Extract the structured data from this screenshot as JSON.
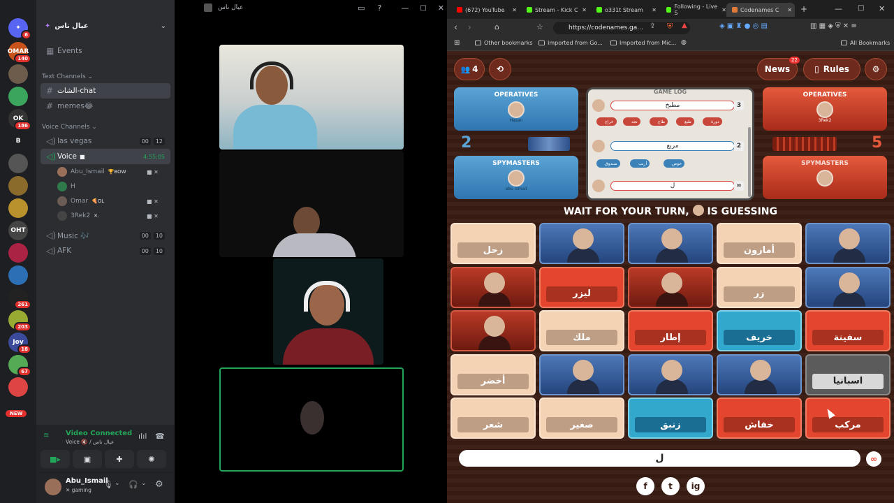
{
  "discord": {
    "server_name": "عيال ناس",
    "servers": [
      {
        "label": "OMAR",
        "badge": "140",
        "color": "#c8541b"
      },
      {
        "label": "",
        "badge": "",
        "color": "#6d5c4b"
      },
      {
        "label": "",
        "badge": "",
        "color": "#3ba55d"
      },
      {
        "label": "OK",
        "badge": "186",
        "color": "#333"
      },
      {
        "label": "B",
        "badge": "",
        "color": "#1e1f22"
      },
      {
        "label": "",
        "badge": "",
        "color": "#555"
      },
      {
        "label": "",
        "badge": "",
        "color": "#8a6b2c"
      },
      {
        "label": "",
        "badge": "",
        "color": "#b9912d"
      },
      {
        "label": "OHT",
        "badge": "",
        "color": "#444"
      },
      {
        "label": "",
        "badge": "",
        "color": "#a24"
      },
      {
        "label": "",
        "badge": "",
        "color": "#2c6fb5"
      },
      {
        "label": "",
        "badge": "261",
        "color": "#222"
      },
      {
        "label": "",
        "badge": "203",
        "color": "#9a3"
      },
      {
        "label": "Joy",
        "badge": "18",
        "color": "#3b4a9a"
      },
      {
        "label": "",
        "badge": "67",
        "color": "#5a5"
      },
      {
        "label": "",
        "badge": "",
        "color": "#d44"
      }
    ],
    "home_badge": "6",
    "new_label": "NEW",
    "events": "Events",
    "text_channels_label": "Text Channels",
    "text_channels": [
      "الشات-chat",
      "memes😂"
    ],
    "voice_channels_label": "Voice Channels",
    "voice_channels": [
      {
        "name": "las vegas",
        "a": "00",
        "b": "12"
      },
      {
        "name": "Voice",
        "time": "4:55:05"
      }
    ],
    "voice_users": [
      {
        "name": "Abu_Ismail",
        "tag": "🏆BOW"
      },
      {
        "name": "H",
        "tag": ""
      },
      {
        "name": "Omar",
        "tag": "🍕OL"
      },
      {
        "name": "3Rek2",
        "tag": "✕."
      }
    ],
    "other_channels": [
      {
        "name": "Music 🎶",
        "a": "00",
        "b": "10"
      },
      {
        "name": "AFK",
        "a": "00",
        "b": "10"
      }
    ],
    "connection_status": "Video Connected",
    "connection_detail": "Voice 🔇 / عيال ناس",
    "username": "Abu_Ismail",
    "user_status": "✕ gaming"
  },
  "stage": {
    "title": "عيال ناس"
  },
  "browser": {
    "tabs": [
      {
        "label": "(672) YouTube",
        "color": "#f00"
      },
      {
        "label": "Stream - Kick C",
        "color": "#53fc18"
      },
      {
        "label": "o331t Stream",
        "color": "#53fc18"
      },
      {
        "label": "Following - Live S",
        "color": "#53fc18"
      },
      {
        "label": "Codenames C",
        "color": "#e07a3a"
      }
    ],
    "url": "https://codenames.ga...",
    "bookmarks": [
      "Other bookmarks",
      "Imported from Go...",
      "Imported from Mic..."
    ],
    "all_bookmarks": "All Bookmarks"
  },
  "game": {
    "player_count": "4",
    "news_label": "News",
    "news_badge": "22",
    "rules_label": "Rules",
    "blue": {
      "operatives_label": "OPERATIVES",
      "operative": "Hasan",
      "spymasters_label": "SPYMASTERS",
      "spymaster": "abu Ismail",
      "score": "2"
    },
    "red": {
      "operatives_label": "OPERATIVES",
      "operative": "3Rek2",
      "spymasters_label": "SPYMASTERS",
      "spymaster": "",
      "score": "5"
    },
    "game_log_label": "GAME LOG",
    "log": [
      {
        "clue": "مطبخ",
        "n": "3",
        "team": "red"
      },
      {
        "clue": "مربع",
        "n": "2",
        "team": "blue"
      },
      {
        "clue": "ل",
        "n": "∞",
        "team": "red"
      }
    ],
    "log_chips_red": [
      "خراج",
      "نجد",
      "طاع",
      "طبع",
      "دورة"
    ],
    "log_chips_blue": [
      "صندوق",
      "أرنب",
      "حوض"
    ],
    "status_text": "WAIT FOR YOUR TURN,",
    "status_suffix": "IS GUESSING",
    "cards": [
      {
        "w": "زحل",
        "t": "n"
      },
      {
        "w": "",
        "t": "pb"
      },
      {
        "w": "",
        "t": "pb"
      },
      {
        "w": "أمازون",
        "t": "n"
      },
      {
        "w": "",
        "t": "pb"
      },
      {
        "w": "",
        "t": "pr"
      },
      {
        "w": "ليزر",
        "t": "r"
      },
      {
        "w": "",
        "t": "pr"
      },
      {
        "w": "زر",
        "t": "n"
      },
      {
        "w": "",
        "t": "pb"
      },
      {
        "w": "",
        "t": "pr"
      },
      {
        "w": "ملك",
        "t": "n"
      },
      {
        "w": "إطار",
        "t": "r"
      },
      {
        "w": "خريف",
        "t": "b"
      },
      {
        "w": "سفينة",
        "t": "r"
      },
      {
        "w": "أخضر",
        "t": "n"
      },
      {
        "w": "",
        "t": "pb"
      },
      {
        "w": "",
        "t": "pb"
      },
      {
        "w": "",
        "t": "pb"
      },
      {
        "w": "اسبانيا",
        "t": "a"
      },
      {
        "w": "شعر",
        "t": "n"
      },
      {
        "w": "صغير",
        "t": "n"
      },
      {
        "w": "زنبق",
        "t": "b"
      },
      {
        "w": "خفاش",
        "t": "r"
      },
      {
        "w": "مركب",
        "t": "r"
      }
    ],
    "clue_text": "ل",
    "clue_number": "∞",
    "social": [
      "f",
      "t",
      "ig"
    ]
  }
}
